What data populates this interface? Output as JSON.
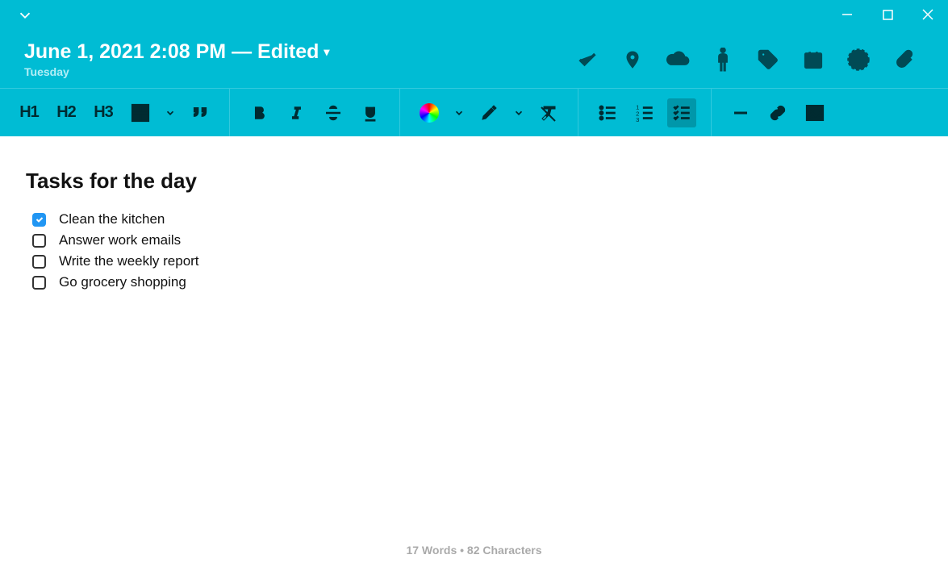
{
  "window": {
    "controls": {
      "minimize": "minimize",
      "maximize": "maximize",
      "close": "close"
    }
  },
  "header": {
    "title": "June 1, 2021 2:08 PM — Edited",
    "subtitle": "Tuesday",
    "meta_icons": [
      "check",
      "location",
      "cloud",
      "person",
      "tag",
      "calendar",
      "face",
      "attachment"
    ]
  },
  "toolbar": {
    "h1": "H1",
    "h2": "H2",
    "h3": "H3",
    "active_list": "checklist"
  },
  "content": {
    "heading": "Tasks for the day",
    "tasks": [
      {
        "label": "Clean the kitchen",
        "checked": true
      },
      {
        "label": "Answer work emails",
        "checked": false
      },
      {
        "label": "Write the weekly report",
        "checked": false
      },
      {
        "label": "Go grocery shopping",
        "checked": false
      }
    ]
  },
  "status": {
    "text": "17 Words • 82 Characters"
  }
}
